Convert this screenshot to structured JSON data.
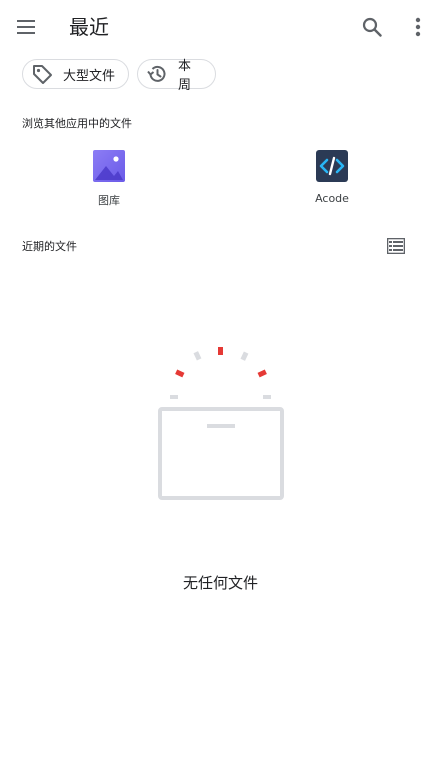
{
  "app_bar": {
    "title": "最近",
    "menu_icon": "hamburger-menu-icon",
    "search_icon": "search-icon",
    "more_icon": "more-vert-icon"
  },
  "filters": [
    {
      "label": "大型文件",
      "icon": "tag-icon"
    },
    {
      "label": "本周",
      "icon": "history-icon"
    }
  ],
  "browse_section": {
    "label": "浏览其他应用中的文件",
    "apps": [
      {
        "label": "图库",
        "icon": "gallery-icon",
        "color": "#7c6cf2"
      },
      {
        "label": "Acode",
        "icon": "acode-icon",
        "color": "#2b3a55"
      }
    ]
  },
  "recent_section": {
    "label": "近期的文件",
    "view_toggle_icon": "list-view-icon"
  },
  "empty_state": {
    "message": "无任何文件",
    "icon": "empty-box-icon"
  },
  "colors": {
    "text_primary": "#202124",
    "chip_border": "#dadce0",
    "accent_red": "#e53935",
    "illustration_gray": "#dadce0"
  }
}
